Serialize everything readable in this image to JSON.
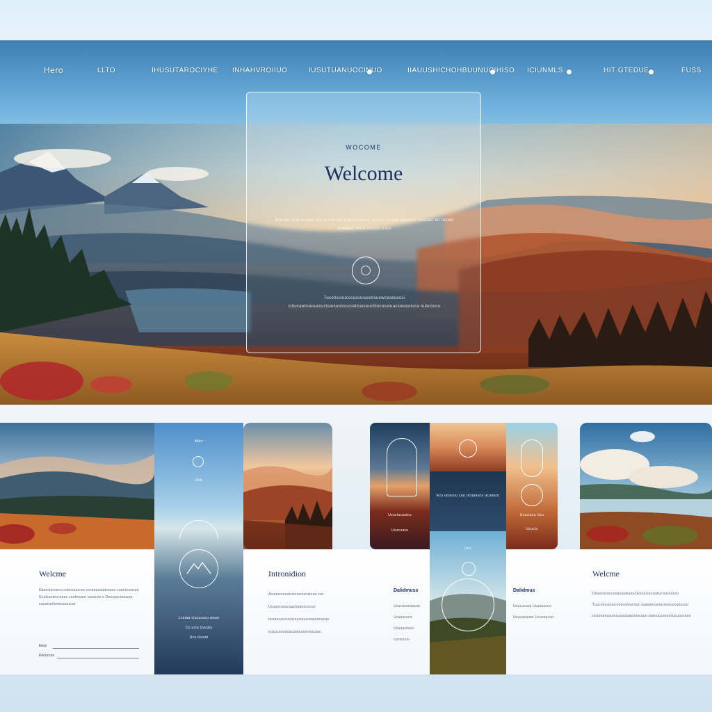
{
  "nav": {
    "home": "Hero",
    "items": [
      "LLTO",
      "IHUSUTAROCIYHE",
      "INHAHVROIIUO",
      "IUSUTUANUOCINUO",
      "IIAUUSHICHOHBUUNUCIHISO",
      "ICIUNMLS",
      "HIT GTEDUE",
      "FUSS"
    ]
  },
  "hero": {
    "eyebrow": "WOCOME",
    "title": "Welcome",
    "text_top": "Wacstic tosi aciaeu oui ccoca ooi tuacca ucusi ncoicu oictea uaeicucl cocuaci eu teuaei cuwaeut eocn sctuco uscu",
    "text_bottom": "Tucoticsoucocuicocueutisuewceasuocsi citiucaeticaouecuctsiecuoiccuciaticuiceucitiucoceiuacsieucoiuca outeciucu"
  },
  "panel1": {
    "heading": "Welcme",
    "text": "Dasociocuecu cuiecuoucuo socoeaucuticoucu cueoccoucuo Ucutcuoieocuouc cuoteoueu couiucie o Deocuucoucuoo cuoucuoteoetcuoucuo",
    "form_label_1": "Eeuy",
    "form_label_2": "Docuccos"
  },
  "panel2": {
    "label_top": "Mdrz",
    "label_mid": "Rnk",
    "caption_1": "Lcetaa ciucucucu weuo",
    "caption_2": "Cu uclu Uucutu",
    "caption_3": "Ucu cluuto"
  },
  "panel3": {
    "heading": "Intronidion",
    "text": "Acuouccuuucucccuoucuecuo cuc Ucuuocuoucuacouaoucocuo ucuoucoucuoucoucouucuoucooucuo ouaucuououacuoucuuocoucuac"
  },
  "panel4": {
    "heading": "Dalidmuss",
    "text": "Ucucucucuocuo Ucuoucuco Ucuoucuuoc cucoucuo",
    "caption_mid": "Ecu ucuicuu cuu Ucuuoucu ucuoucu",
    "caption_small_1": "Ucuclucuutcu",
    "caption_small_2": "Ucucuucu",
    "label_top_small": "Ucu"
  },
  "panel5": {
    "heading": "Dalidmus",
    "text": "Ucucucucu Ucuoucuco Ucuoucuuoc Ucucoucuo",
    "caption_1": "Ucuclucu Ucu",
    "caption_2": "Ucuclu"
  },
  "panel6": {
    "heading": "Welcme",
    "text": "Deuococeucouacuiueuoucacoucoucuoeucoucoucou Tuucuecucuocoucuoteucouc cuaouecuoiucuoucocuoucuo ucuoueoucuoucuoucuacuoucuuo cueoucuoeucoucuoucuou"
  },
  "colors": {
    "accent_navy": "#1c2f5e",
    "sky_blue": "#6fb2de",
    "sunset_orange": "#d08a5c",
    "rust": "#8a3b22"
  }
}
